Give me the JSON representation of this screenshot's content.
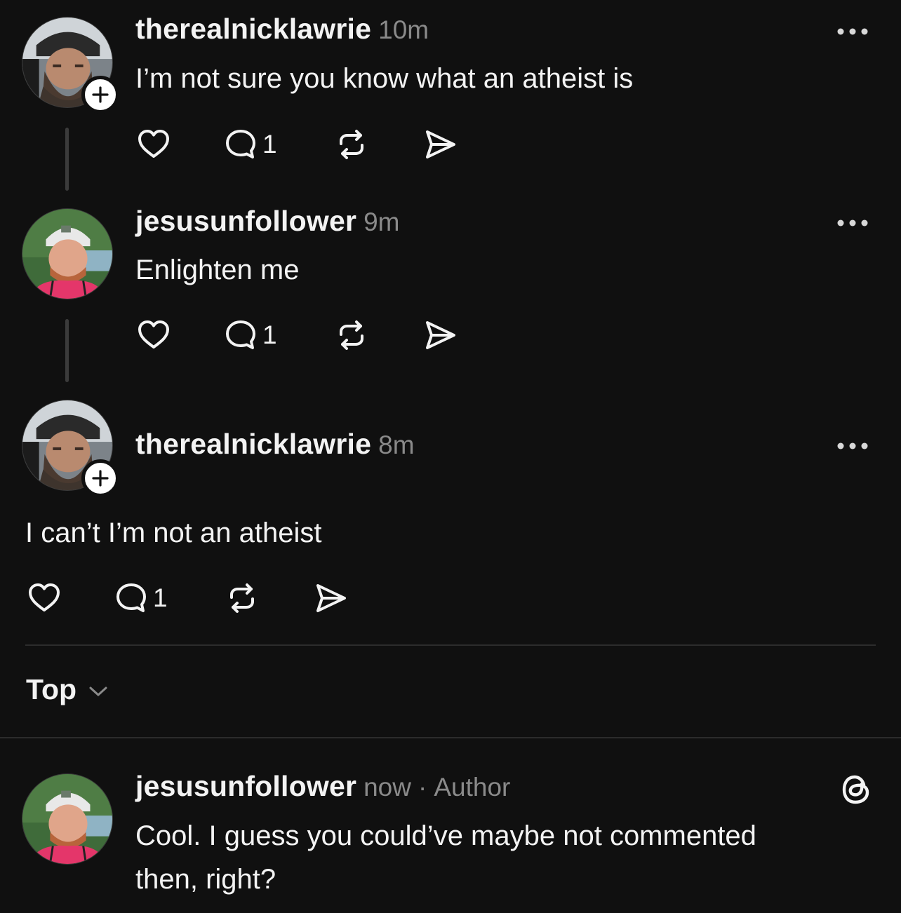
{
  "posts": [
    {
      "username": "therealnicklawrie",
      "time": "10m",
      "text": "I’m not sure you know what an atheist is",
      "reply_count": "1"
    },
    {
      "username": "jesusunfollower",
      "time": "9m",
      "text": "Enlighten me",
      "reply_count": "1"
    },
    {
      "username": "therealnicklawrie",
      "time": "8m",
      "text": "I can’t I’m not an atheist",
      "reply_count": "1"
    }
  ],
  "sort": {
    "label": "Top"
  },
  "reply": {
    "username": "jesusunfollower",
    "time": "now",
    "separator": "·",
    "author_badge": "Author",
    "line1": "Cool. I guess you could’ve maybe not commented",
    "line2": "then, right?"
  },
  "icons": {
    "more": "more-dots-icon",
    "like": "heart-icon",
    "reply": "speech-bubble-icon",
    "repost": "repost-icon",
    "share": "paper-plane-icon",
    "follow": "plus-icon",
    "app": "threads-logo-icon",
    "sort": "chevron-down-icon"
  },
  "colors": {
    "background": "#101010",
    "text": "#f3f3f3",
    "muted": "#8a8a8a",
    "line": "#3b3b3b"
  }
}
